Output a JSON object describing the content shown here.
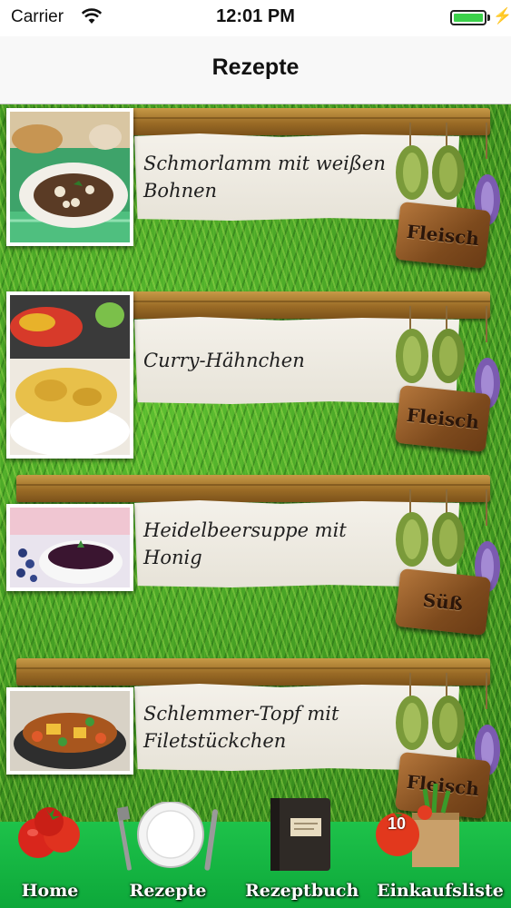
{
  "status_bar": {
    "carrier": "Carrier",
    "time": "12:01 PM",
    "battery_level": 1.0
  },
  "nav": {
    "title": "Rezepte"
  },
  "recipes": [
    {
      "title": "Schmorlamm mit weißen Bohnen",
      "category": "Fleisch"
    },
    {
      "title": "Curry-Hähnchen",
      "category": "Fleisch"
    },
    {
      "title": "Heidelbeersuppe mit Honig",
      "category": "Süß"
    },
    {
      "title": "Schlemmer-Topf mit Filetstückchen",
      "category": "Fleisch"
    }
  ],
  "tabs": [
    {
      "label": "Home",
      "icon": "tomato-icon"
    },
    {
      "label": "Rezepte",
      "icon": "plate-cutlery-icon"
    },
    {
      "label": "Rezeptbuch",
      "icon": "book-icon"
    },
    {
      "label": "Einkaufsliste",
      "icon": "shopping-bag-icon",
      "badge": "10"
    }
  ],
  "colors": {
    "grass": "#3f9a22",
    "tabbar": "#12b540",
    "wood": "#9a6b26"
  }
}
